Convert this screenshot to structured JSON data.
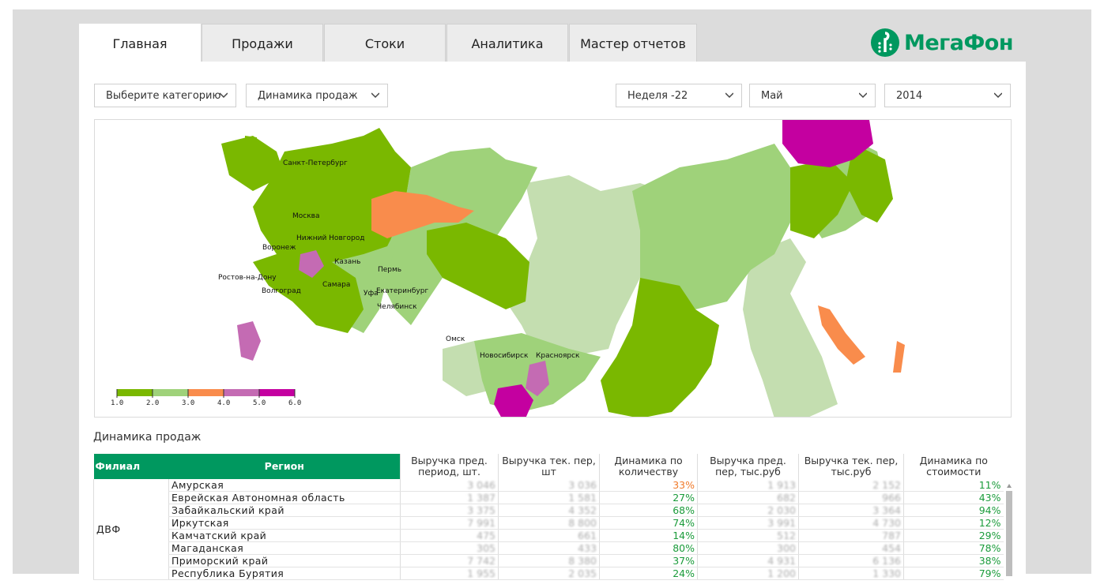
{
  "tabs": [
    {
      "label": "Главная",
      "active": true
    },
    {
      "label": "Продажи"
    },
    {
      "label": "Стоки"
    },
    {
      "label": "Аналитика"
    },
    {
      "label": "Мастер отчетов"
    }
  ],
  "logo": {
    "text": "МегаФон"
  },
  "filters": {
    "category": "Выберите категорию",
    "report": "Динамика продаж",
    "week": "Неделя -22",
    "month": "Май",
    "year": "2014"
  },
  "map": {
    "cities": [
      "Санкт-Петербург",
      "Москва",
      "Нижний Новгород",
      "Воронеж",
      "Казань",
      "Пермь",
      "Ростов-на-Дону",
      "Самара",
      "Уфа",
      "Екатеринбург",
      "Волгоград",
      "Челябинск",
      "Омск",
      "Новосибирск",
      "Красноярск"
    ],
    "legend": {
      "colors": [
        "#7ab800",
        "#9fd27a",
        "#f98c4c",
        "#c46bb3",
        "#c400a0"
      ],
      "ticks": [
        "1.0",
        "2.0",
        "3.0",
        "4.0",
        "5.0",
        "6.0"
      ]
    }
  },
  "table": {
    "title": "Динамика продаж",
    "headers": {
      "branch": "Филиал",
      "region": "Регион",
      "c1": "Выручка пред. период, шт.",
      "c2": "Выручка тек. пер, шт",
      "c3": "Динамика по количеству",
      "c4": "Выручка пред. пер, тыс.руб",
      "c5": "Выручка тек. пер, тыс.руб",
      "c6": "Динамика по стоимости"
    },
    "branch": "ДВФ",
    "rows": [
      {
        "region": "Амурская",
        "c1": "3 046",
        "c2": "3 036",
        "c3": "33%",
        "c4": "1 913",
        "c5": "2 152",
        "c6": "11%",
        "c3_color": "orange"
      },
      {
        "region": "Еврейская Автономная область",
        "c1": "1 387",
        "c2": "1 581",
        "c3": "27%",
        "c4": "682",
        "c5": "966",
        "c6": "43%"
      },
      {
        "region": "Забайкальский край",
        "c1": "3 375",
        "c2": "4 352",
        "c3": "68%",
        "c4": "2 030",
        "c5": "3 364",
        "c6": "94%"
      },
      {
        "region": "Иркутская",
        "c1": "7 991",
        "c2": "8 800",
        "c3": "74%",
        "c4": "3 991",
        "c5": "4 730",
        "c6": "12%"
      },
      {
        "region": "Камчатский край",
        "c1": "475",
        "c2": "661",
        "c3": "14%",
        "c4": "512",
        "c5": "787",
        "c6": "29%"
      },
      {
        "region": "Магаданская",
        "c1": "305",
        "c2": "433",
        "c3": "80%",
        "c4": "300",
        "c5": "454",
        "c6": "78%"
      },
      {
        "region": "Приморский край",
        "c1": "7 742",
        "c2": "8 380",
        "c3": "37%",
        "c4": "4 931",
        "c5": "6 136",
        "c6": "38%"
      },
      {
        "region": "Республика Бурятия",
        "c1": "1 955",
        "c2": "2 035",
        "c3": "24%",
        "c4": "1 200",
        "c5": "1 330",
        "c6": "79%"
      }
    ]
  }
}
